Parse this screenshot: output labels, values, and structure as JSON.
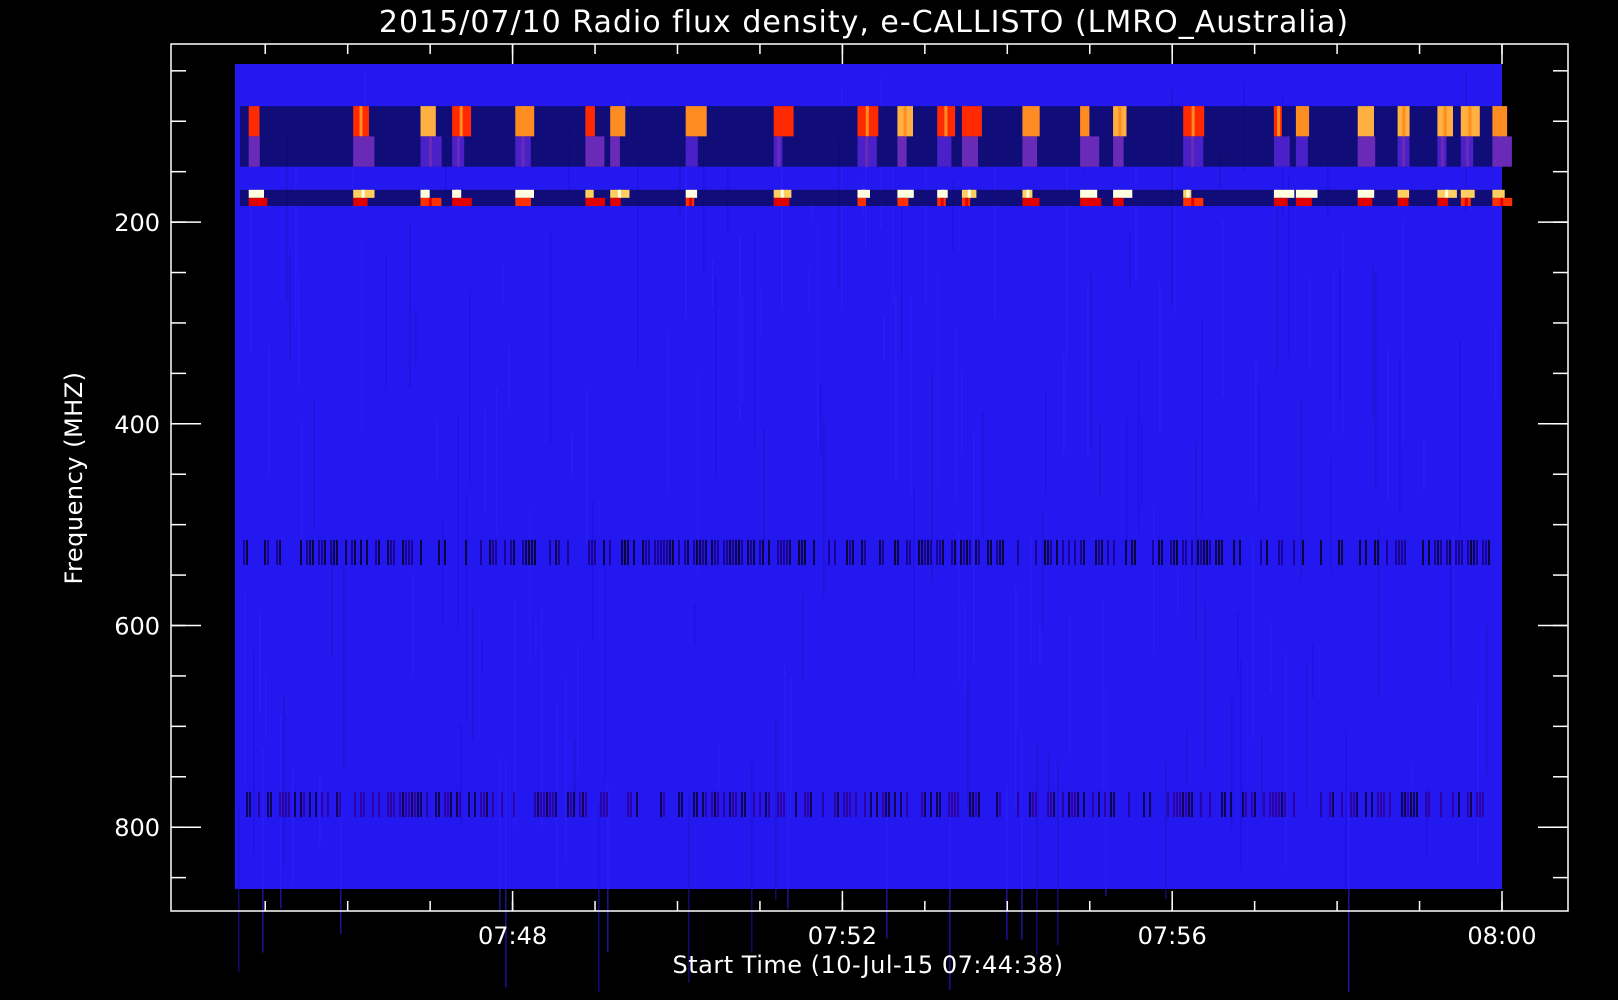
{
  "chart_data": {
    "type": "heatmap",
    "title": "2015/07/10  Radio flux density, e-CALLISTO (LMRO_Australia)",
    "xlabel": "Start Time (10-Jul-15 07:44:38)",
    "ylabel": "Frequency (MHZ)",
    "x_range": [
      "07:44:38",
      "08:00:00"
    ],
    "x_ticks": [
      "07:48",
      "07:52",
      "07:56",
      "08:00"
    ],
    "y_range_mhz": [
      45,
      870
    ],
    "y_ticks": [
      200,
      400,
      600,
      800
    ],
    "y_minor_tick_step_mhz": 50,
    "x_minor_tick_step_min": 1,
    "y_inverted": true,
    "colormap": [
      "#000022",
      "#1a00aa",
      "#2a1aff",
      "#cc0000",
      "#ff2a00",
      "#ff9a30",
      "#ffffc0"
    ],
    "background_color": "#2418f0",
    "interference_bands": [
      {
        "freq_from_mhz": 85,
        "freq_to_mhz": 115,
        "level": "high",
        "colors": [
          "#ff8c20",
          "#ff2a00",
          "#ffb040"
        ]
      },
      {
        "freq_from_mhz": 115,
        "freq_to_mhz": 145,
        "level": "medium",
        "colors": [
          "#6a2ab8",
          "#4a20c8"
        ]
      },
      {
        "freq_from_mhz": 168,
        "freq_to_mhz": 176,
        "level": "very-high",
        "colors": [
          "#ffffe0",
          "#ffd060"
        ]
      },
      {
        "freq_from_mhz": 176,
        "freq_to_mhz": 184,
        "level": "high",
        "colors": [
          "#e00000",
          "#ff3000"
        ]
      },
      {
        "freq_from_mhz": 515,
        "freq_to_mhz": 540,
        "level": "low",
        "colors": [
          "#060018",
          "#180080"
        ]
      },
      {
        "freq_from_mhz": 765,
        "freq_to_mhz": 790,
        "level": "low",
        "colors": [
          "#0a0030",
          "#300090"
        ]
      }
    ],
    "burst_times": [
      "07:44:48",
      "07:46:04",
      "07:46:53",
      "07:47:16",
      "07:48:02",
      "07:48:53",
      "07:49:11",
      "07:50:06",
      "07:51:10",
      "07:52:11",
      "07:52:40",
      "07:53:09",
      "07:53:27",
      "07:54:11",
      "07:54:53",
      "07:55:17",
      "07:56:08",
      "07:57:14",
      "07:57:30",
      "07:58:15",
      "07:58:44",
      "07:59:13",
      "07:59:30",
      "07:59:53"
    ]
  }
}
